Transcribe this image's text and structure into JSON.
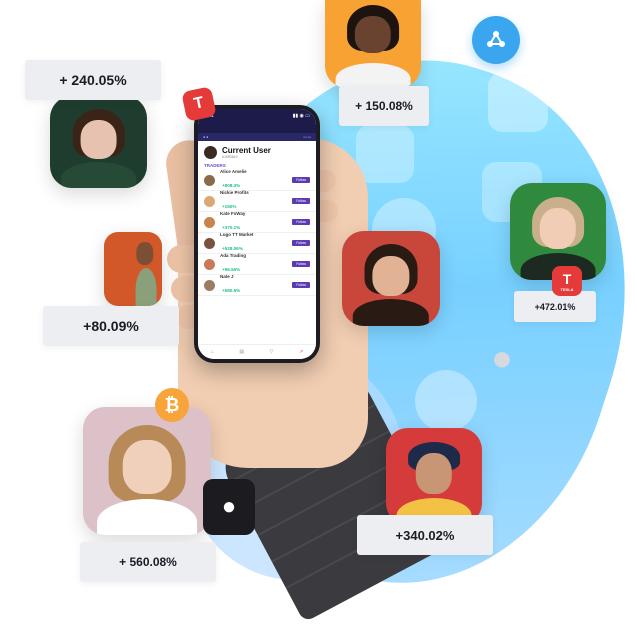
{
  "cards": {
    "c1": "+ 240.05%",
    "c2": "+ 150.08%",
    "c3": "+80.09%",
    "c4": "+472.01%",
    "c5": "+ 560.08%",
    "c6": "+340.02%"
  },
  "icons": {
    "tesla_label": "TESLA",
    "ripple": "ripple-icon",
    "bitcoin": "bitcoin-icon",
    "apple": "apple-icon",
    "tesla": "tesla-icon"
  },
  "phone": {
    "time": "9:41",
    "current_user": "Current User",
    "user_id": "#1983842",
    "section": "TRADERS",
    "tab_left": "Follow",
    "tab_right": "",
    "traders": [
      {
        "name": "Alice Amelie",
        "gain": "+808.3%",
        "button": "Follow",
        "color": "#8a6a4a"
      },
      {
        "name": "Nickie Profits",
        "gain": "+150%",
        "button": "Follow",
        "color": "#d9a873"
      },
      {
        "name": "Kate FxWay",
        "gain": "+370.1%",
        "button": "Follow",
        "color": "#c9834d"
      },
      {
        "name": "Lugo TT Market",
        "gain": "+528.06%",
        "button": "Follow",
        "color": "#7a5340"
      },
      {
        "name": "Ada Trading",
        "gain": "+96.55%",
        "button": "Follow",
        "color": "#c97a59"
      },
      {
        "name": "Nate J",
        "gain": "+580.5%",
        "button": "Follow",
        "color": "#9e7b63"
      }
    ]
  },
  "colors": {
    "accent": "#5b3bb3",
    "gain": "#1ec08a",
    "blob": "#6fd3ff",
    "card_bg": "#eceef2"
  }
}
